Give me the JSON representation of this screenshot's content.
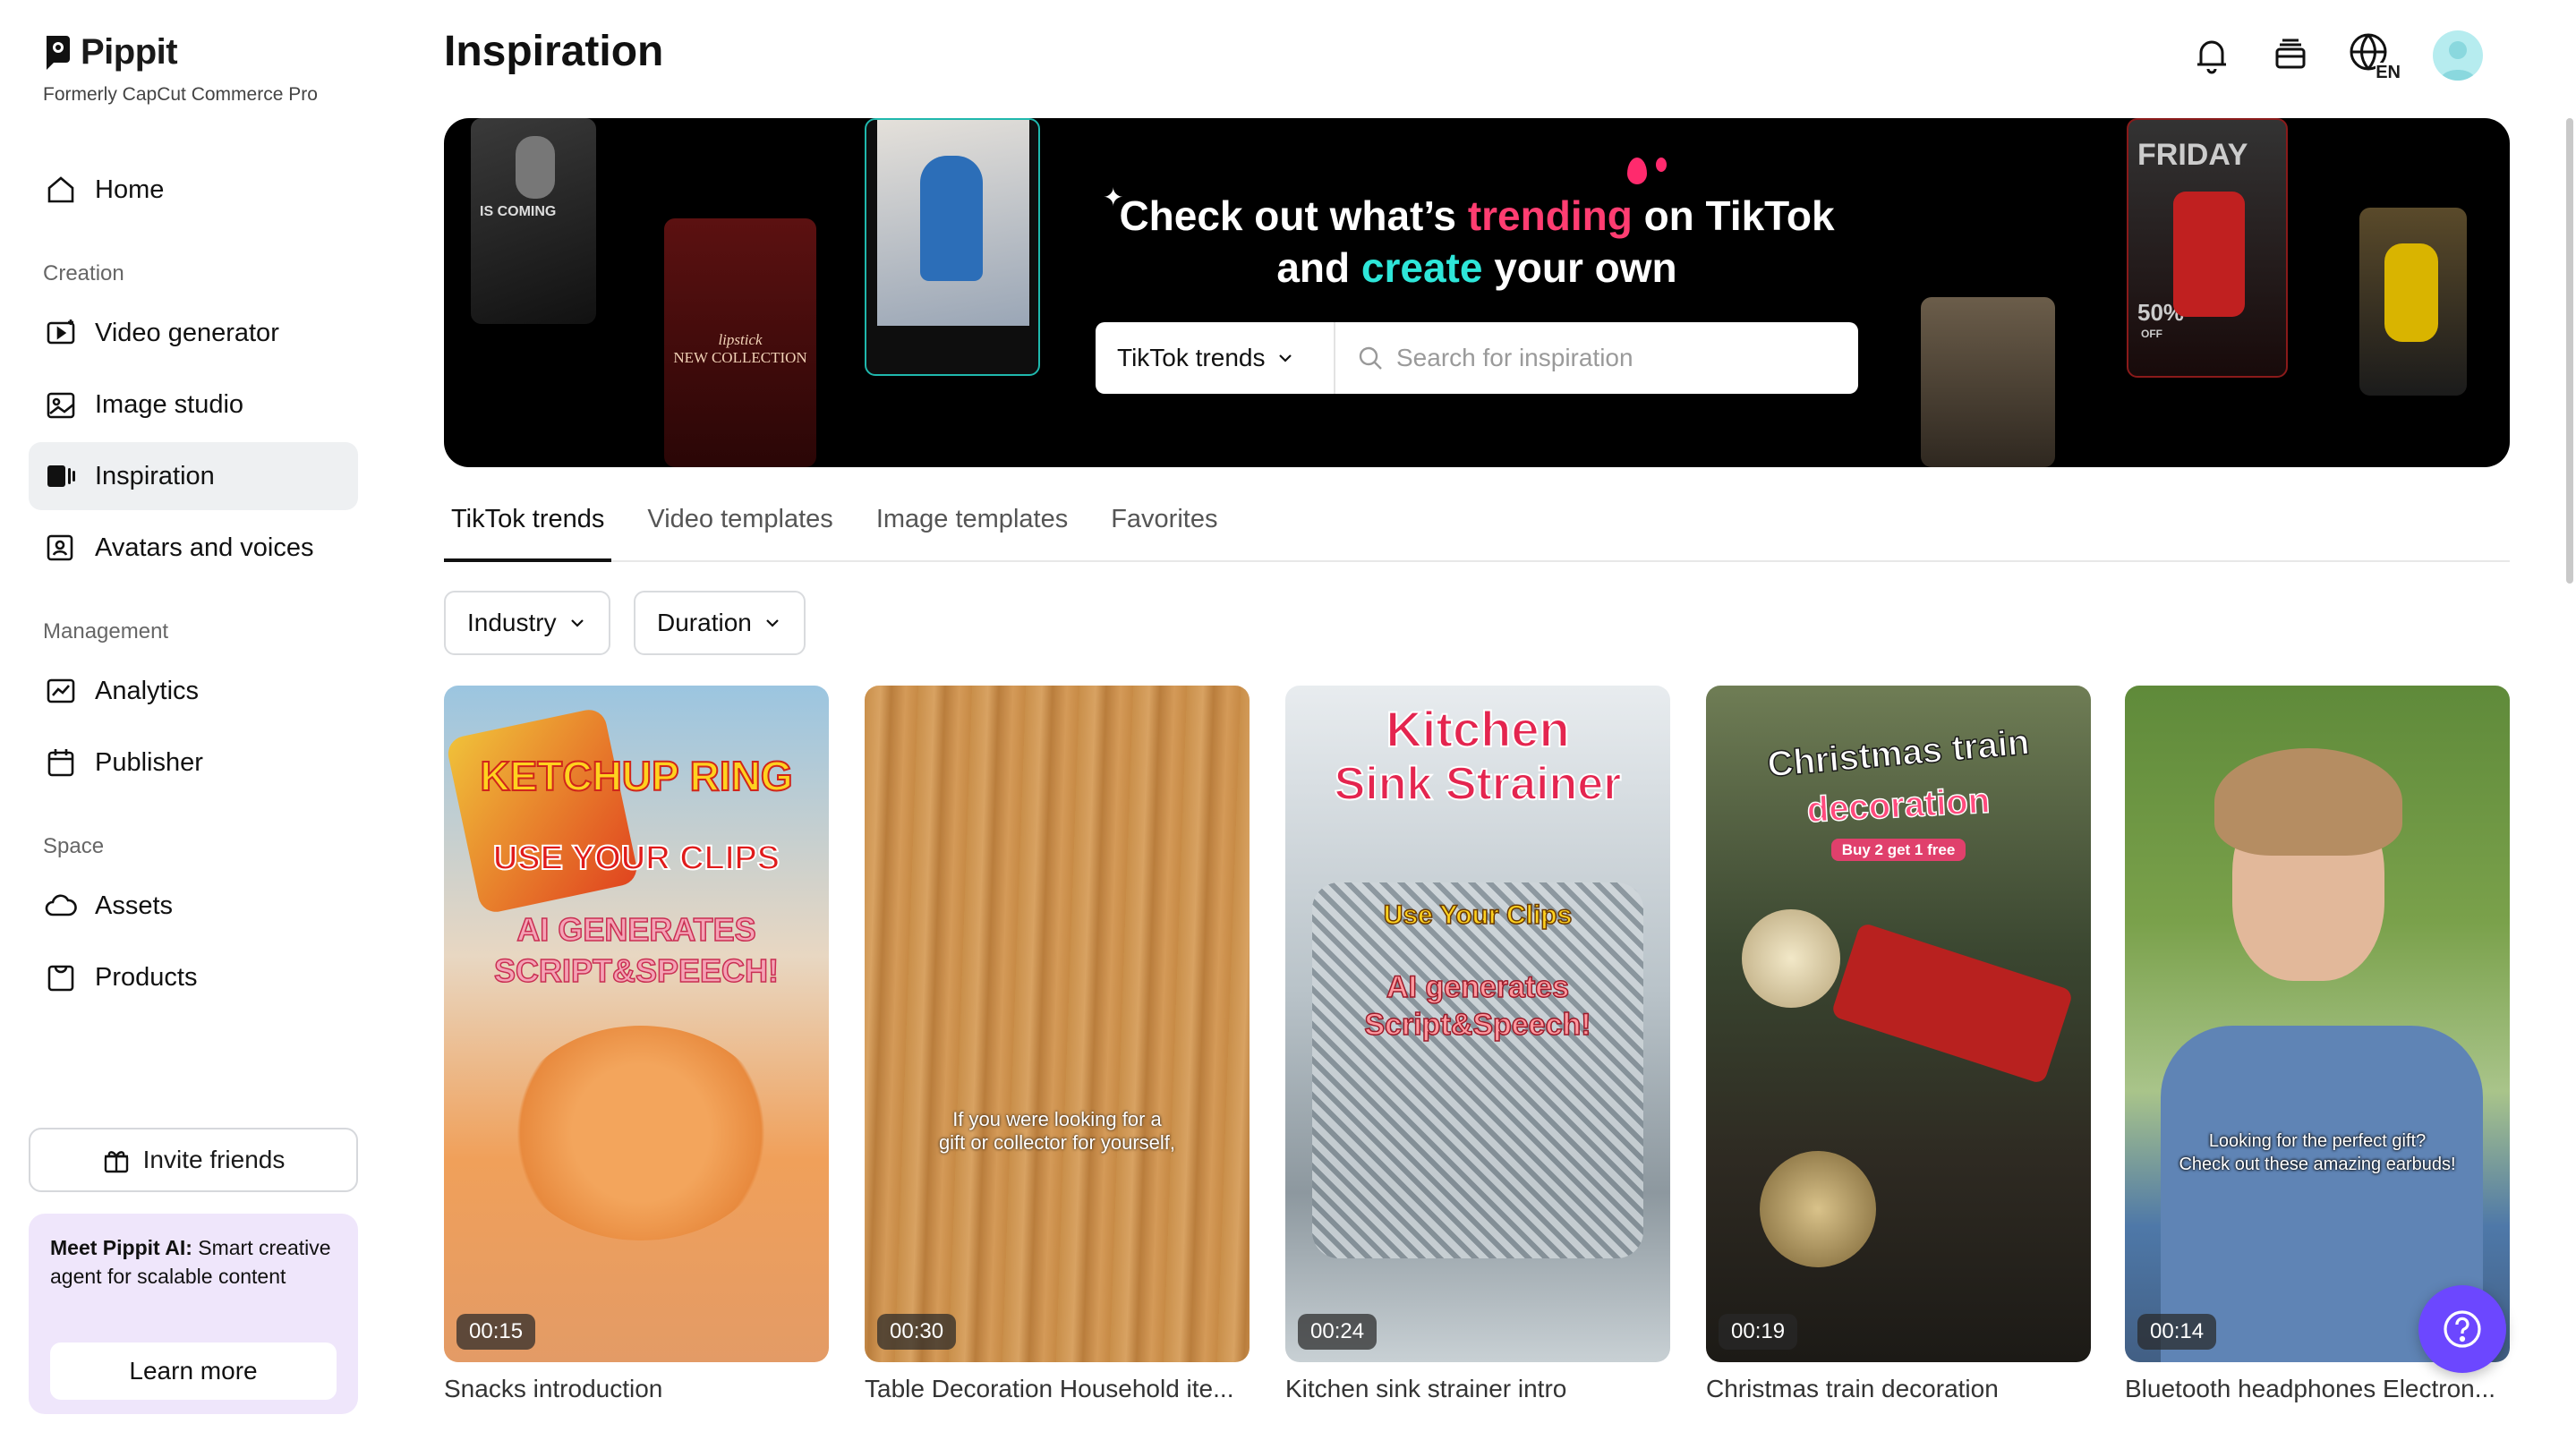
{
  "brand": {
    "name": "Pippit",
    "subtitle": "Formerly CapCut Commerce Pro"
  },
  "sidebar": {
    "home": "Home",
    "sections": {
      "creation": "Creation",
      "management": "Management",
      "space": "Space"
    },
    "creation_items": [
      "Video generator",
      "Image studio",
      "Inspiration",
      "Avatars and voices"
    ],
    "management_items": [
      "Analytics",
      "Publisher"
    ],
    "space_items": [
      "Assets",
      "Products"
    ],
    "active_item": "Inspiration",
    "invite_label": "Invite friends",
    "promo": {
      "bold": "Meet Pippit AI:",
      "text": " Smart creative agent for scalable content",
      "button": "Learn more"
    }
  },
  "header": {
    "title": "Inspiration",
    "language": "EN"
  },
  "banner": {
    "line1_a": "Check out what’s ",
    "line1_highlight": "trending",
    "line1_b": " on TikTok",
    "line2_a": "and ",
    "line2_highlight": "create",
    "line2_b": " your own",
    "search_source": "TikTok trends",
    "search_placeholder": "Search for inspiration",
    "phone_texts": [
      "IS COMING",
      "lipstick",
      "NEW COLLECTION",
      "FRIDAY",
      "50%",
      "OFF"
    ]
  },
  "tabs": [
    "TikTok trends",
    "Video templates",
    "Image templates",
    "Favorites"
  ],
  "active_tab": "TikTok trends",
  "filters": {
    "industry": "Industry",
    "duration": "Duration"
  },
  "cards": [
    {
      "title": "Snacks introduction",
      "duration": "00:15",
      "overlay": [
        "KETCHUP RING",
        "USE YOUR CLIPS",
        "AI GENERATES",
        "SCRIPT&SPEECH!"
      ]
    },
    {
      "title": "Table Decoration Household ite...",
      "duration": "00:30",
      "overlay": [
        "If you were looking for a",
        "gift or collector for yourself,"
      ]
    },
    {
      "title": "Kitchen sink strainer intro",
      "duration": "00:24",
      "overlay": [
        "Kitchen",
        "Sink Strainer",
        "Use Your Clips",
        "AI generates",
        "Script&Speech!"
      ]
    },
    {
      "title": "Christmas train decoration",
      "duration": "00:19",
      "overlay": [
        "Christmas train",
        "decoration",
        "Buy 2 get 1 free"
      ]
    },
    {
      "title": "Bluetooth headphones Electron...",
      "duration": "00:14",
      "overlay": [
        "Looking for the perfect gift?",
        "Check out these amazing earbuds!"
      ]
    }
  ],
  "colors": {
    "accent_trending": "#ff3d71",
    "accent_create": "#2ee6d9",
    "help_button": "#6c47ff",
    "promo_bg": "#efe6fb",
    "active_nav_bg": "#eef0f2"
  }
}
